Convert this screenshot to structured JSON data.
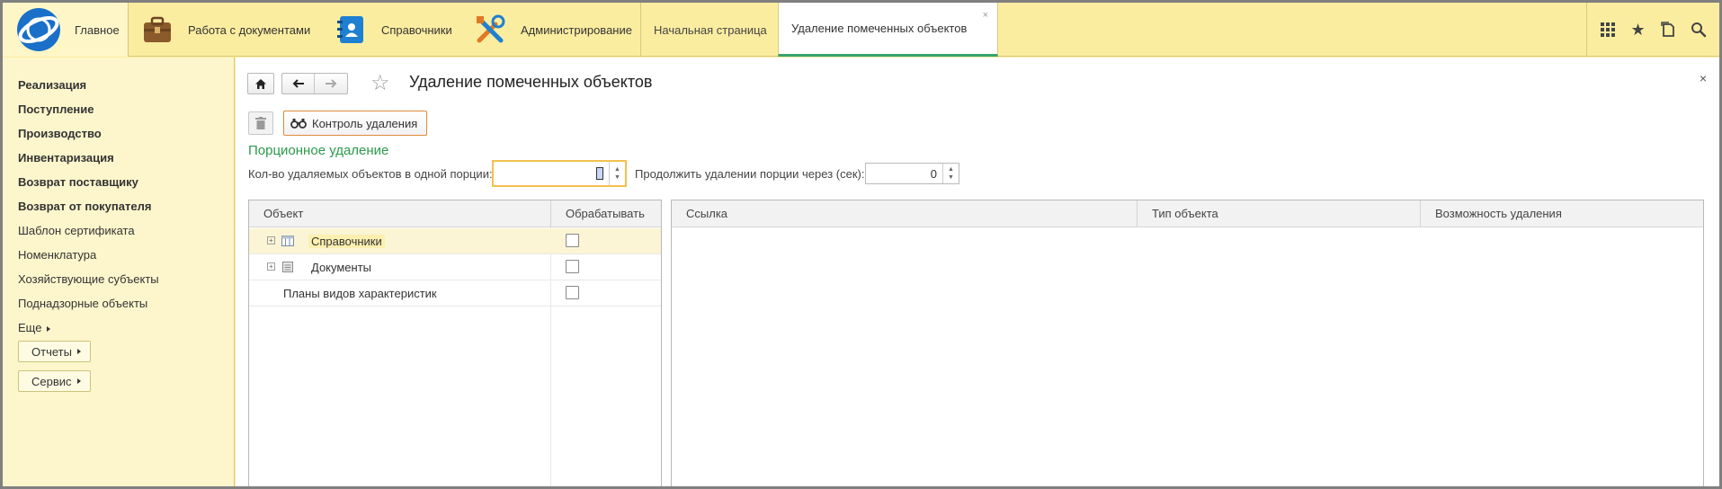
{
  "topbar": {
    "home_label": "Главное",
    "sections": [
      {
        "label": "Работа с документами",
        "icon": "briefcase-icon"
      },
      {
        "label": "Справочники",
        "icon": "address-book-icon"
      },
      {
        "label": "Администрирование",
        "icon": "tools-icon"
      }
    ],
    "tabs": [
      {
        "label": "Начальная страница",
        "active": false
      },
      {
        "label": "Удаление помеченных объектов",
        "active": true
      }
    ],
    "tab_close": "×",
    "tools": [
      "apps-grid-icon",
      "favorites-star-icon",
      "history-icon",
      "search-icon"
    ]
  },
  "sidebar": {
    "items": [
      {
        "label": "Реализация",
        "bold": true
      },
      {
        "label": "Поступление",
        "bold": true
      },
      {
        "label": "Производство",
        "bold": true
      },
      {
        "label": "Инвентаризация",
        "bold": true
      },
      {
        "label": "Возврат поставщику",
        "bold": true
      },
      {
        "label": "Возврат от покупателя",
        "bold": true
      },
      {
        "label": "Шаблон сертификата",
        "bold": false
      },
      {
        "label": "Номенклатура",
        "bold": false
      },
      {
        "label": "Хозяйствующие субъекты",
        "bold": false
      },
      {
        "label": "Поднадзорные объекты",
        "bold": false
      },
      {
        "label": "Еще",
        "bold": false
      }
    ],
    "reports_label": "Отчеты",
    "service_label": "Сервис"
  },
  "form": {
    "title": "Удаление помеченных объектов",
    "close": "×",
    "control_button": "Контроль удаления",
    "group_title": "Порционное удаление",
    "portion_label": "Кол-во удаляемых объектов в одной порции:",
    "portion_value": "",
    "delay_label": "Продолжить удалении порции через (сек):",
    "delay_value": "0"
  },
  "objects_table": {
    "columns": [
      "Объект",
      "Обрабатывать"
    ],
    "rows": [
      {
        "label": "Справочники",
        "expandable": true,
        "icon": "catalog-icon",
        "selected": true,
        "checked": false
      },
      {
        "label": "Документы",
        "expandable": true,
        "icon": "document-icon",
        "selected": false,
        "checked": false
      },
      {
        "label": "Планы видов характеристик",
        "expandable": false,
        "icon": "",
        "selected": false,
        "checked": false
      }
    ]
  },
  "results_table": {
    "columns": [
      "Ссылка",
      "Тип объекта",
      "Возможность удаления"
    ]
  },
  "colors": {
    "accent_green": "#2a9a4a",
    "topbar_bg": "#fbeda0",
    "focus_border": "#f2c14e",
    "control_border": "#e08a3a"
  }
}
